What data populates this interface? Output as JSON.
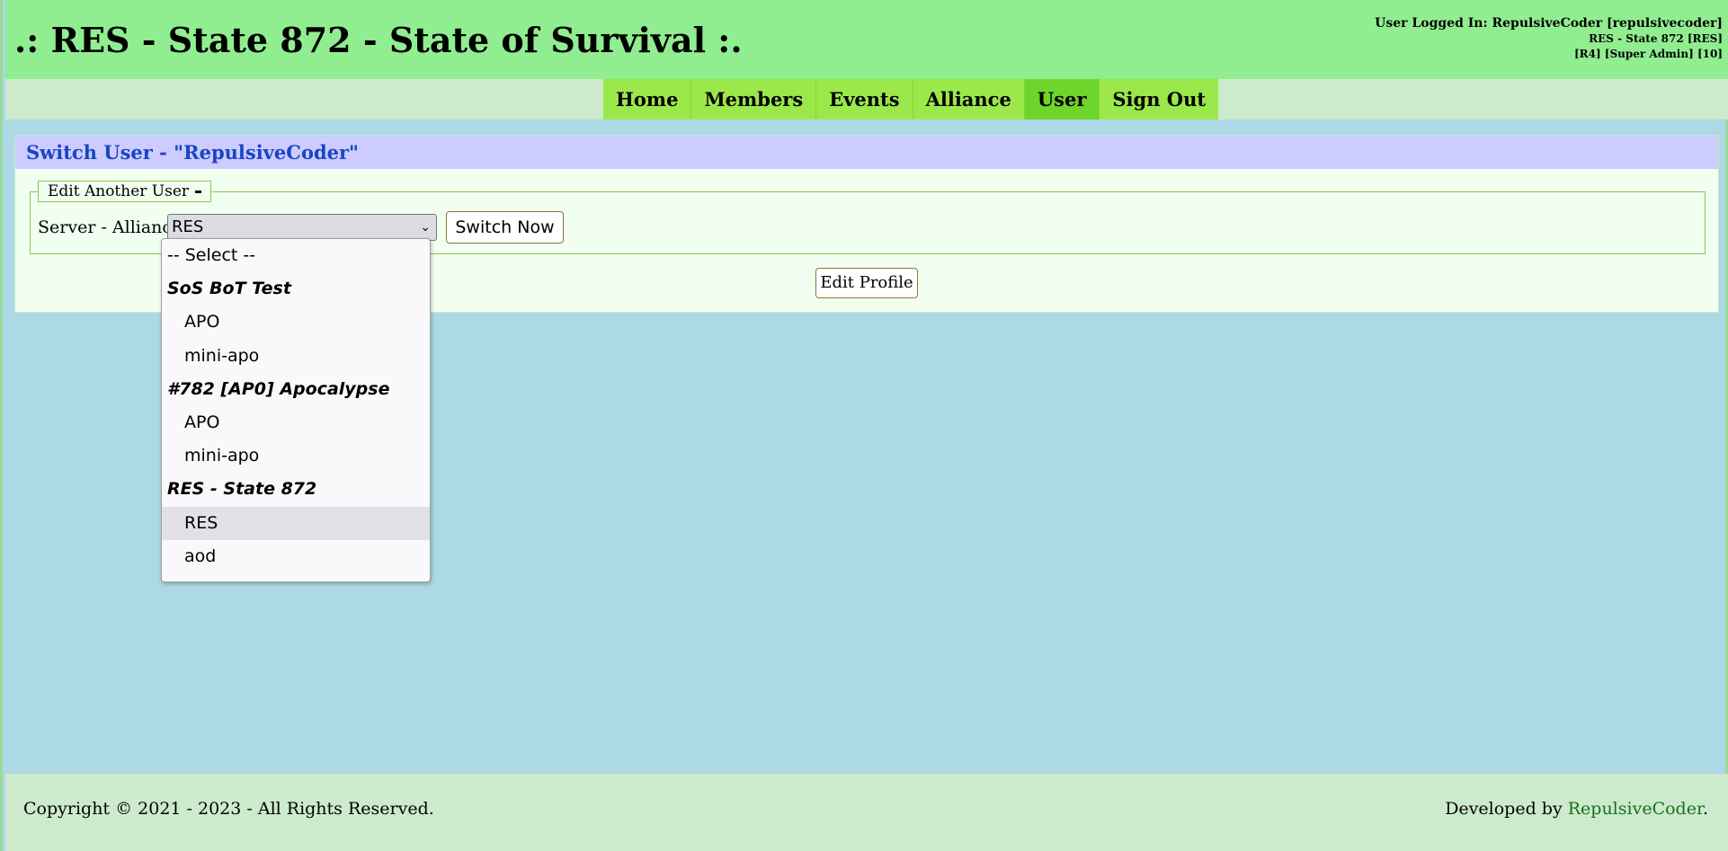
{
  "header": {
    "title": ".: RES - State 872 - State of Survival :.",
    "user_line1": "User Logged In: RepulsiveCoder [repulsivecoder]",
    "user_line2": "RES - State 872 [RES]",
    "user_line3": "[R4] [Super Admin] [10]"
  },
  "nav": {
    "items": [
      {
        "label": "Home",
        "active": false
      },
      {
        "label": "Members",
        "active": false
      },
      {
        "label": "Events",
        "active": false
      },
      {
        "label": "Alliance",
        "active": false
      },
      {
        "label": "User",
        "active": true
      },
      {
        "label": "Sign Out",
        "active": false
      }
    ]
  },
  "panel": {
    "title": "Switch User - \"RepulsiveCoder\"",
    "fieldset_legend": "Edit Another User",
    "field_label": "Server - Alliance",
    "select_value": "RES",
    "switch_button": "Switch Now",
    "edit_profile_button": "Edit Profile"
  },
  "dropdown": {
    "placeholder": "-- Select --",
    "groups": [
      {
        "label": "SoS BoT Test",
        "options": [
          "APO",
          "mini-apo"
        ]
      },
      {
        "label": "#782 [AP0] Apocalypse",
        "options": [
          "APO",
          "mini-apo"
        ]
      },
      {
        "label": "RES - State 872",
        "options": [
          "RES",
          "aod"
        ]
      }
    ],
    "selected": "RES"
  },
  "footer": {
    "copyright": "Copyright © 2021 - 2023 - All Rights Reserved.",
    "developed_by": "Developed by ",
    "developer": "RepulsiveCoder",
    "suffix": "."
  },
  "colors": {
    "header_bg": "#90ee90",
    "nav_bg": "#9be84a",
    "nav_active": "#6fd42b",
    "page_bg": "#add8e6",
    "panel_header_bg": "#ccccff",
    "panel_title": "#1a44c4"
  }
}
